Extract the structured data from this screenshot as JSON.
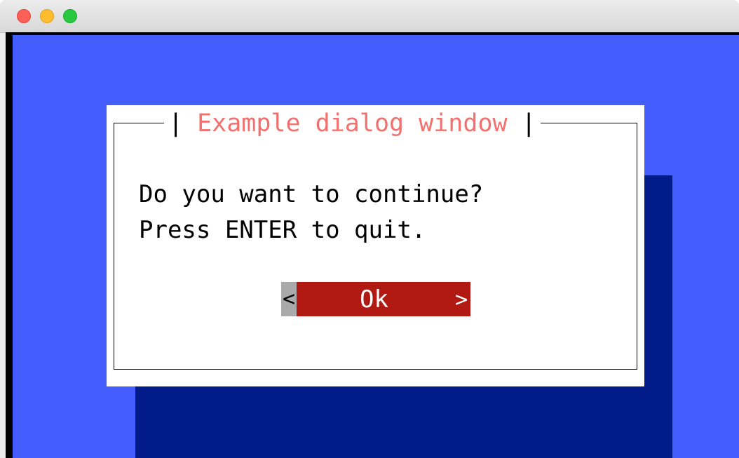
{
  "window": {
    "controls": [
      "close",
      "minimize",
      "maximize"
    ]
  },
  "dialog": {
    "title": "Example dialog window",
    "title_bar_char": "|",
    "message_line1": "Do you want to continue?",
    "message_line2": "Press ENTER to quit.",
    "ok_button": {
      "left_marker": "<",
      "label": "Ok",
      "right_marker": ">"
    }
  },
  "colors": {
    "screen_background": "#435efd",
    "shadow": "#021b8a",
    "title_text": "#f2716f",
    "button_background": "#b01a12",
    "button_marker_background": "#aaaaaa"
  }
}
